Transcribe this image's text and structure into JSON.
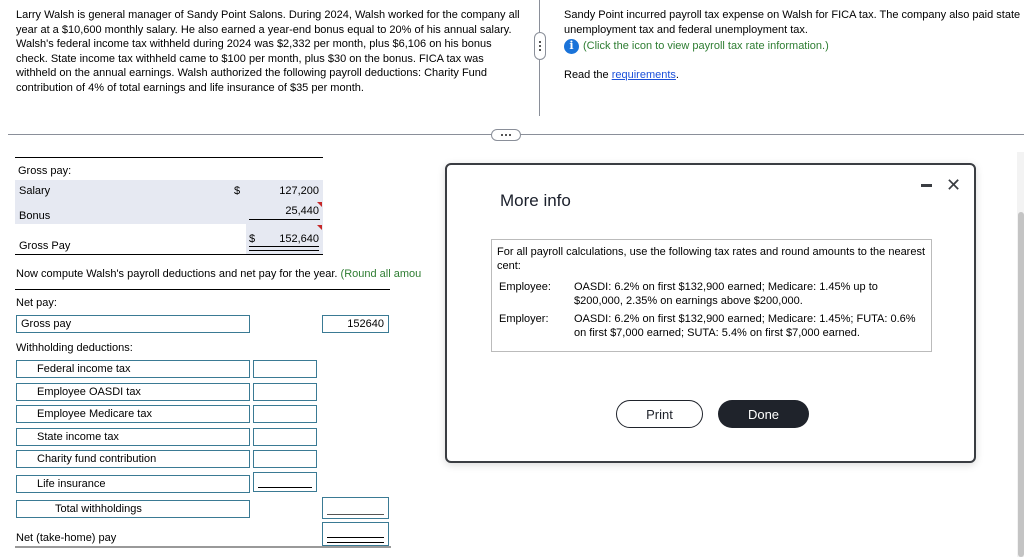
{
  "problem": {
    "text": "Larry Walsh is general manager of Sandy Point Salons. During 2024, Walsh worked for the company all year at a $10,600 monthly salary. He also earned a year-end bonus equal to 20% of his annual salary. Walsh's federal income tax withheld during 2024 was $2,332 per month, plus $6,106 on his bonus check. State income tax withheld came to $100 per month, plus $30 on the bonus. FICA tax was withheld on the annual earnings. Walsh authorized the following payroll deductions: Charity Fund contribution of 4% of total earnings and life insurance of $35 per month."
  },
  "right_panel": {
    "text": "Sandy Point incurred payroll tax expense on Walsh for FICA tax. The company also paid state unemployment tax and federal unemployment tax.",
    "info_hint": "(Click the icon to view payroll tax rate information.)",
    "read_prefix": "Read the ",
    "requirements_link": "requirements",
    "read_suffix": "."
  },
  "gross_pay_table": {
    "heading": "Gross pay:",
    "salary_label": "Salary",
    "salary_currency": "$",
    "salary_value": "127,200",
    "bonus_label": "Bonus",
    "bonus_value": "25,440",
    "total_label": "Gross Pay",
    "total_currency": "$",
    "total_value": "152,640"
  },
  "instruction": {
    "text": "Now compute Walsh's payroll deductions and net pay for the year. ",
    "hint": "(Round all amou"
  },
  "net_pay_form": {
    "net_pay_heading": "Net pay:",
    "gross_pay_label": "Gross pay",
    "gross_pay_value": "152640",
    "withholding_heading": "Withholding deductions:",
    "deductions": [
      {
        "label": "Federal income tax",
        "value": ""
      },
      {
        "label": "Employee OASDI tax",
        "value": ""
      },
      {
        "label": "Employee Medicare tax",
        "value": ""
      },
      {
        "label": "State income tax",
        "value": ""
      },
      {
        "label": "Charity fund contribution",
        "value": ""
      },
      {
        "label": "Life insurance",
        "value": ""
      }
    ],
    "total_label": "Total withholdings",
    "total_value": "",
    "net_label": "Net (take-home) pay",
    "net_value": ""
  },
  "modal": {
    "title": "More info",
    "intro": "For all payroll calculations, use the following tax rates and round amounts to the nearest cent:",
    "rates": [
      {
        "key": "Employee:",
        "value": "OASDI: 6.2% on first $132,900 earned; Medicare: 1.45% up to $200,000, 2.35% on earnings above $200,000."
      },
      {
        "key": "Employer:",
        "value": "OASDI: 6.2% on first $132,900 earned; Medicare: 1.45%; FUTA: 0.6% on first $7,000 earned; SUTA: 5.4% on first $7,000 earned."
      }
    ],
    "print_label": "Print",
    "done_label": "Done",
    "close_glyph": "✕"
  },
  "colors": {
    "accent_green": "#2e7d32",
    "link_blue": "#1a4fd9",
    "input_border": "#3a7a94",
    "button_dark": "#1f232b"
  }
}
